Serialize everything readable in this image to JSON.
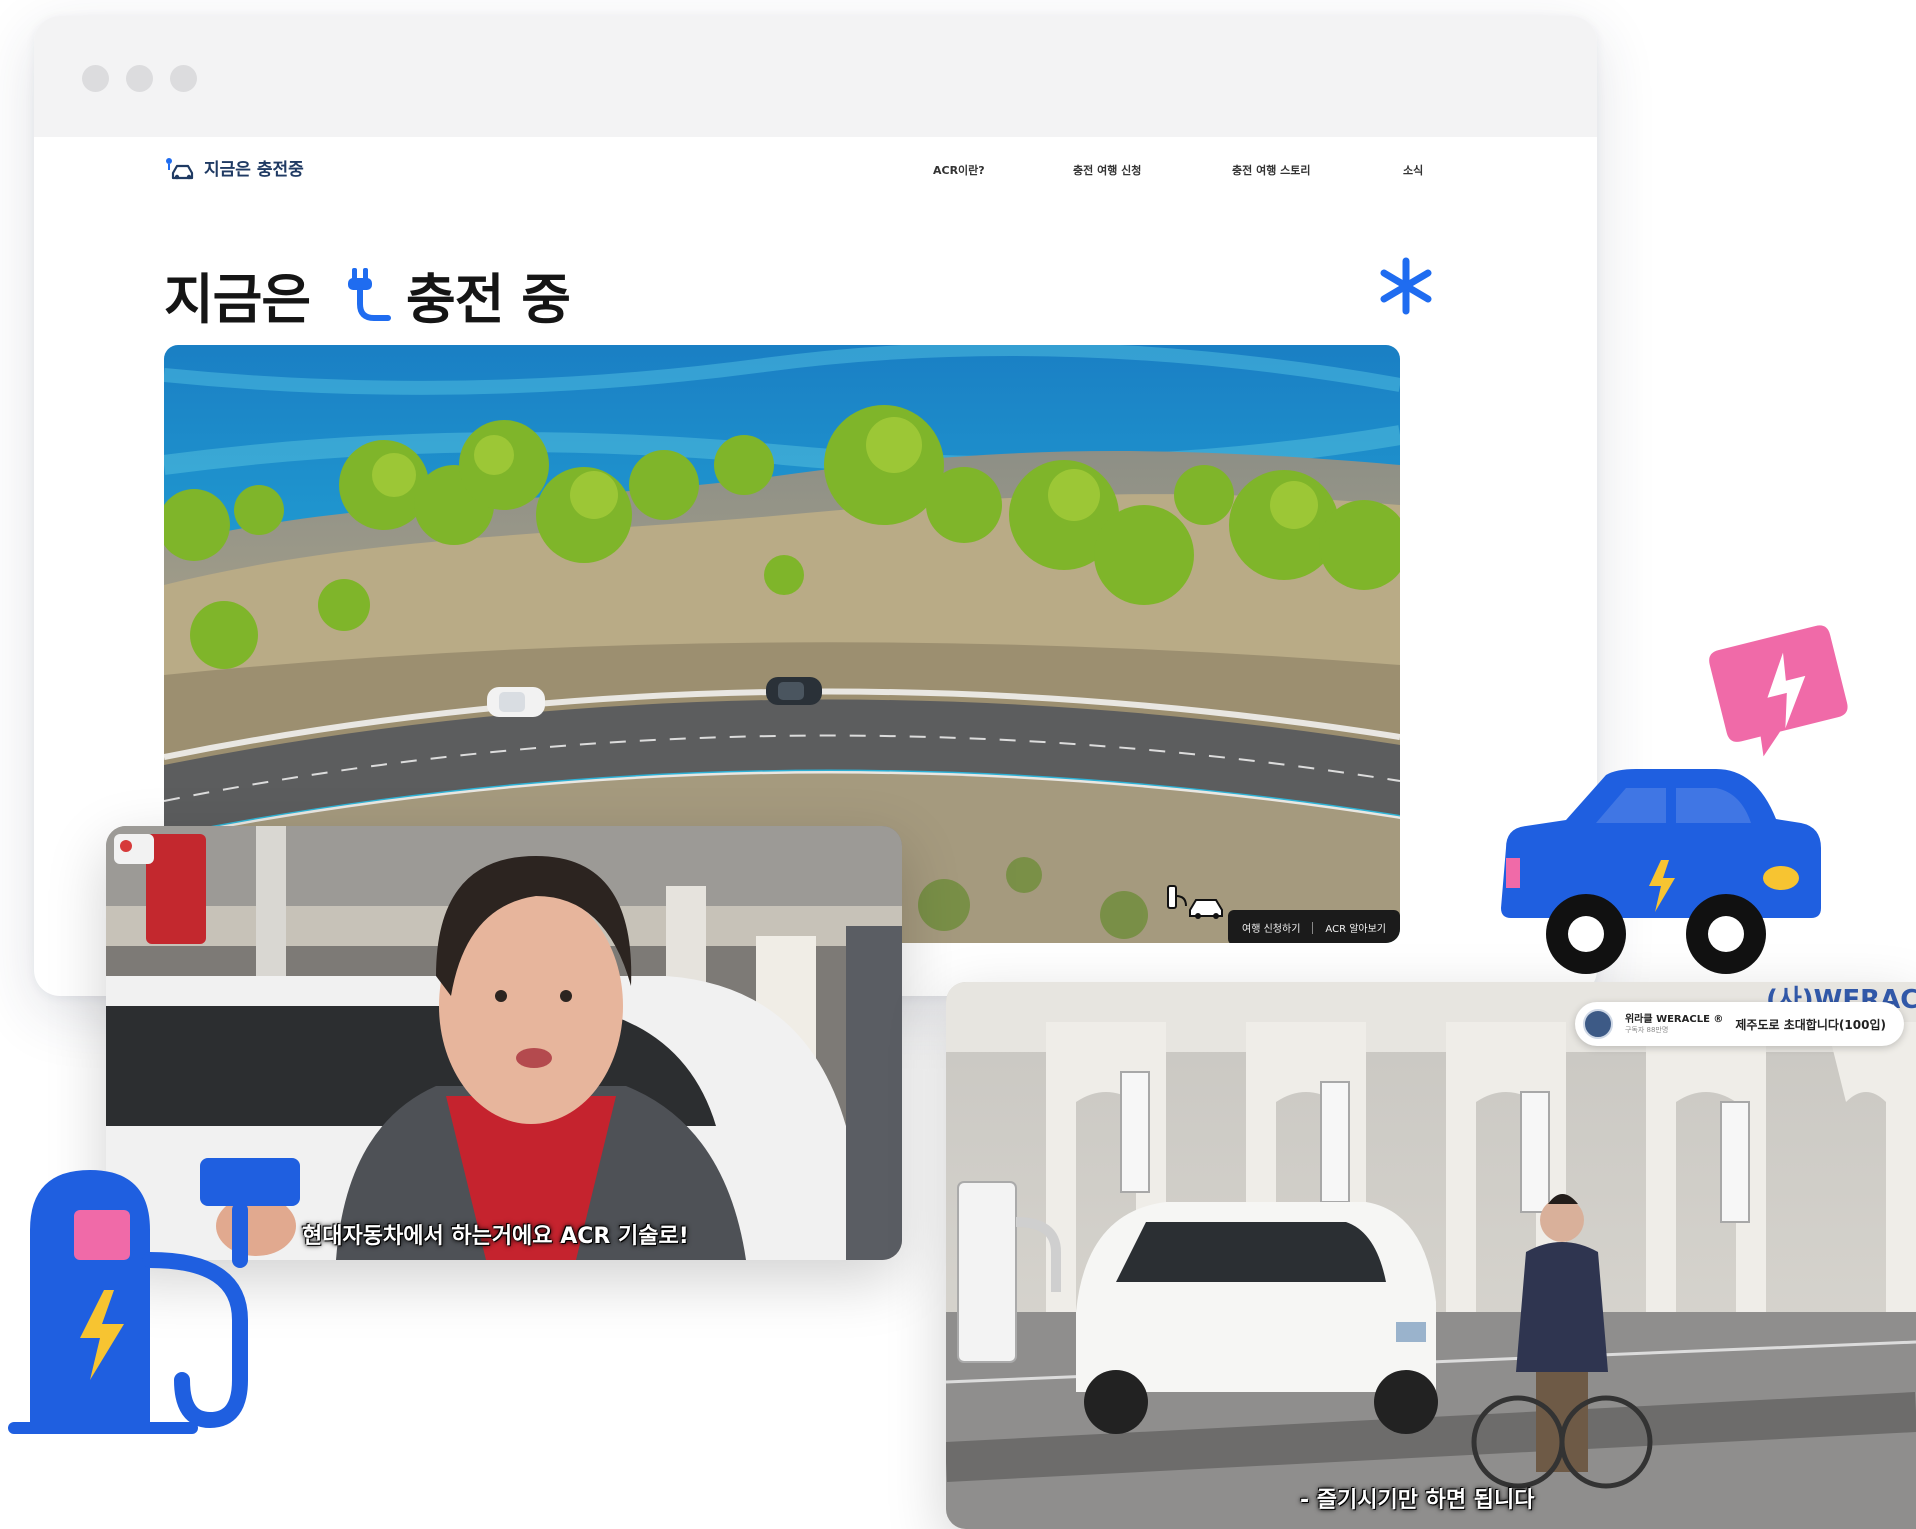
{
  "nav": {
    "logo_text": "지금은 충전중",
    "items": [
      "ACR이란?",
      "충전 여행 신청",
      "충전 여행 스토리",
      "소식"
    ]
  },
  "hero": {
    "title_part1": "지금은",
    "title_part2": "충전 중",
    "badge_left": "여행 신청하기",
    "badge_right": "ACR 알아보기"
  },
  "video1": {
    "caption": "현대자동차에서 하는거에요 ACR 기술로!"
  },
  "video2": {
    "channel_name": "위라클 WERACLE ®",
    "channel_sub": "구독자 88만명",
    "channel_text": "제주도로 초대합니다(100입)",
    "caption": "- 즐기시기만 하면 됩니다",
    "wall_sign": "(사)WERACLE"
  },
  "colors": {
    "accent_blue": "#1f6cf0",
    "pink": "#f06aa8",
    "car_blue": "#1f5fe0",
    "bolt_yellow": "#f7c431"
  }
}
